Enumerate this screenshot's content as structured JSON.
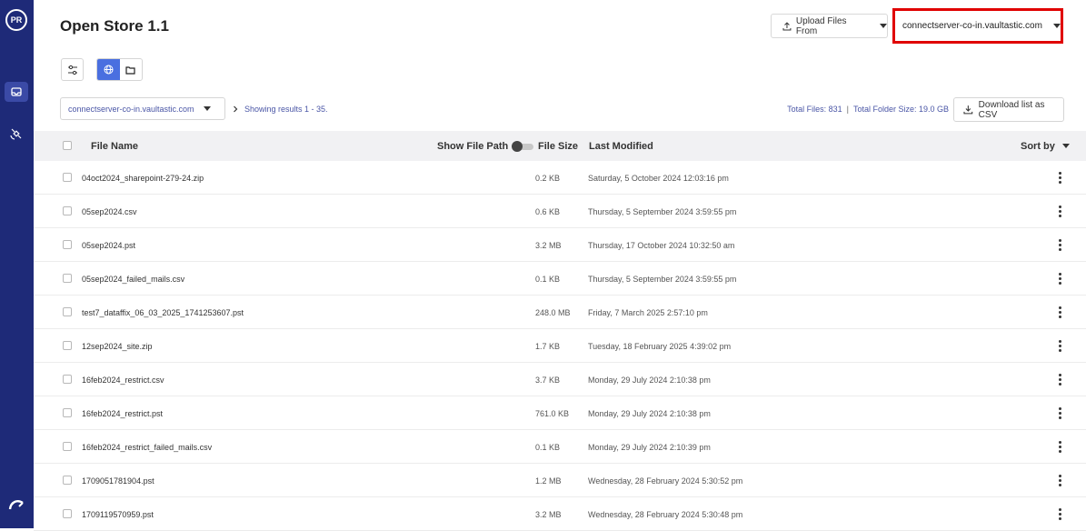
{
  "sidebar": {
    "avatar_initials": "PR",
    "items": [
      {
        "icon": "inbox-icon",
        "active": true
      },
      {
        "icon": "satellite-icon",
        "active": false
      }
    ],
    "bottom_icon": "brand-logo-icon"
  },
  "header": {
    "title": "Open Store 1.1",
    "upload_label": "Upload Files From",
    "server_selected": "connectserver-co-in.vaultastic.com"
  },
  "toolbar": {
    "filter_icon": "filter-sliders-icon",
    "globe_icon": "globe-icon",
    "folder_icon": "folder-icon"
  },
  "subbar": {
    "server_value": "connectserver-co-in.vaultastic.com",
    "results_text": "Showing results 1 - 35.",
    "total_files": "Total Files: 831",
    "separator": "|",
    "total_size": "Total Folder Size: 19.0 GB",
    "csv_label": "Download list as CSV"
  },
  "table": {
    "headers": {
      "file_name": "File Name",
      "show_path": "Show File Path",
      "file_size": "File Size",
      "last_modified": "Last Modified",
      "sort_by": "Sort by"
    },
    "rows": [
      {
        "name": "04oct2024_sharepoint-279-24.zip",
        "size": "0.2 KB",
        "modified": "Saturday, 5 October 2024 12:03:16 pm"
      },
      {
        "name": "05sep2024.csv",
        "size": "0.6 KB",
        "modified": "Thursday, 5 September 2024 3:59:55 pm"
      },
      {
        "name": "05sep2024.pst",
        "size": "3.2 MB",
        "modified": "Thursday, 17 October 2024 10:32:50 am"
      },
      {
        "name": "05sep2024_failed_mails.csv",
        "size": "0.1 KB",
        "modified": "Thursday, 5 September 2024 3:59:55 pm"
      },
      {
        "name": "test7_dataffix_06_03_2025_1741253607.pst",
        "size": "248.0 MB",
        "modified": "Friday, 7 March 2025 2:57:10 pm"
      },
      {
        "name": "12sep2024_site.zip",
        "size": "1.7 KB",
        "modified": "Tuesday, 18 February 2025 4:39:02 pm"
      },
      {
        "name": "16feb2024_restrict.csv",
        "size": "3.7 KB",
        "modified": "Monday, 29 July 2024 2:10:38 pm"
      },
      {
        "name": "16feb2024_restrict.pst",
        "size": "761.0 KB",
        "modified": "Monday, 29 July 2024 2:10:38 pm"
      },
      {
        "name": "16feb2024_restrict_failed_mails.csv",
        "size": "0.1 KB",
        "modified": "Monday, 29 July 2024 2:10:39 pm"
      },
      {
        "name": "1709051781904.pst",
        "size": "1.2 MB",
        "modified": "Wednesday, 28 February 2024 5:30:52 pm"
      },
      {
        "name": "1709119570959.pst",
        "size": "3.2 MB",
        "modified": "Wednesday, 28 February 2024 5:30:48 pm"
      }
    ]
  }
}
